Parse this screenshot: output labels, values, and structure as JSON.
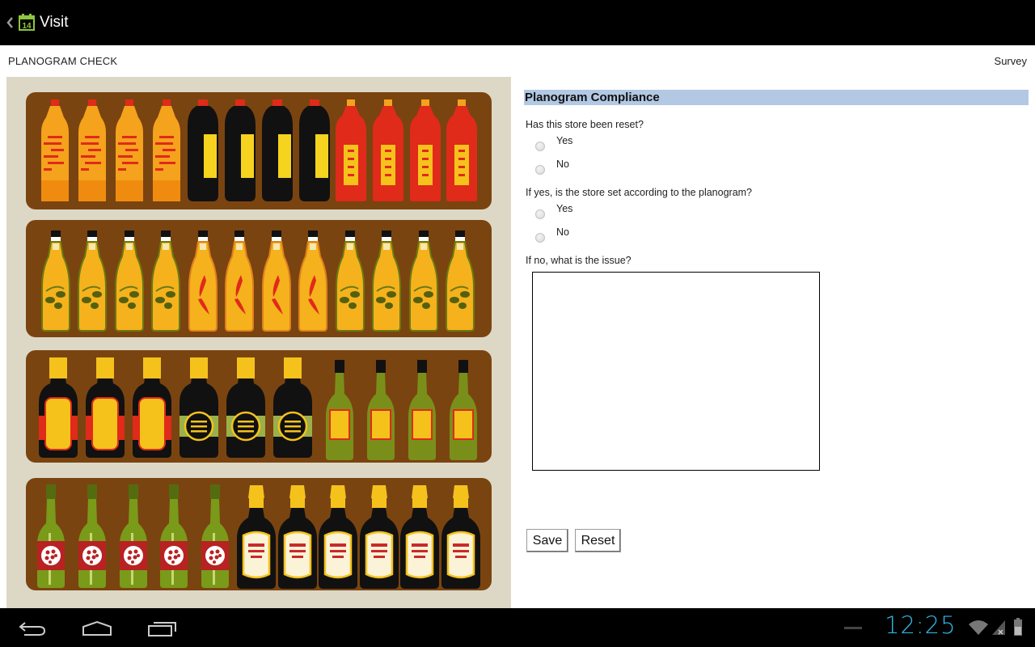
{
  "app": {
    "title": "Visit",
    "calendar_day": "14"
  },
  "subheader": {
    "left": "PLANOGRAM CHECK",
    "right": "Survey"
  },
  "planogram": {
    "image_icon": "shelf-planogram-illustration"
  },
  "form": {
    "section_title": "Planogram Compliance",
    "questions": [
      {
        "text": "Has this store been reset?",
        "options": [
          "Yes",
          "No"
        ],
        "selected": null
      },
      {
        "text": "If yes, is the store set according to the planogram?",
        "options": [
          "Yes",
          "No"
        ],
        "selected": null
      },
      {
        "text": "If no, what is the issue?",
        "value": ""
      }
    ],
    "save_label": "Save",
    "reset_label": "Reset"
  },
  "systembar": {
    "time": "12:25",
    "back_icon": "back-icon",
    "home_icon": "home-icon",
    "recents_icon": "recent-apps-icon",
    "clock_color": "#33b5e5"
  },
  "colors": {
    "section_header_bg": "#b2c8e3",
    "shelf": "#7a4410",
    "image_bg": "#ddd8c6",
    "calendar_icon": "#8cc63f"
  }
}
